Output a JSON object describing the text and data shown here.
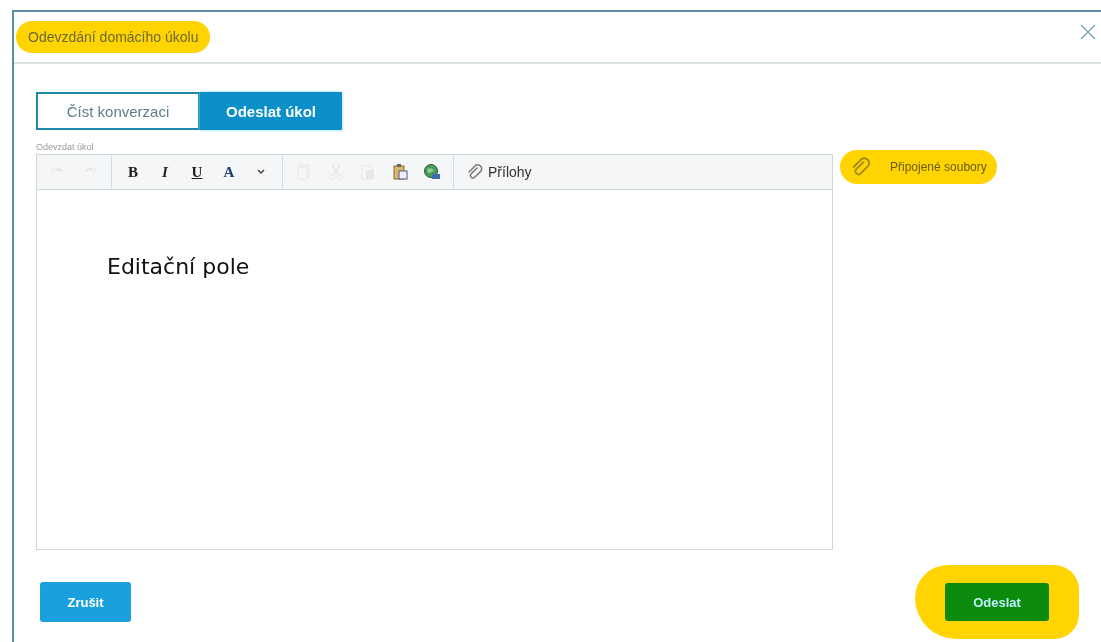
{
  "dialog": {
    "title": "Odevzdání domácího úkolu",
    "title_highlighted": true
  },
  "tabs": [
    {
      "label": "Číst konverzaci",
      "selected": false
    },
    {
      "label": "Odeslat úkol",
      "selected": true
    }
  ],
  "editor": {
    "label": "Odevzdat úkol",
    "toolbar": [
      [
        {
          "kind": "undo",
          "disabled": true
        },
        {
          "kind": "redo",
          "disabled": true
        }
      ],
      [
        {
          "kind": "bold",
          "text": "B",
          "disabled": false
        },
        {
          "kind": "italic",
          "text": "I",
          "disabled": false
        },
        {
          "kind": "underline",
          "text": "U",
          "disabled": false
        },
        {
          "kind": "color",
          "text": "A",
          "disabled": false
        },
        {
          "kind": "dropdown",
          "disabled": false
        }
      ],
      [
        {
          "kind": "copy",
          "disabled": true
        },
        {
          "kind": "cut",
          "disabled": true
        },
        {
          "kind": "paste",
          "disabled": true
        },
        {
          "kind": "paste-special",
          "disabled": false
        },
        {
          "kind": "image",
          "disabled": false
        }
      ],
      [
        {
          "kind": "attach",
          "text": "Přílohy",
          "disabled": false
        }
      ]
    ],
    "content": "Editační pole"
  },
  "attached_files": {
    "label": "Připojené soubory",
    "highlighted": true
  },
  "buttons": [
    {
      "kind": "cancel",
      "label": "Zrušit",
      "highlighted": false
    },
    {
      "kind": "send",
      "label": "Odeslat",
      "highlighted": true
    }
  ]
}
